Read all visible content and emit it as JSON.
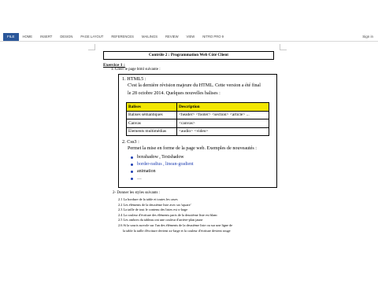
{
  "ribbon": {
    "file_tab": "FILE",
    "tabs": [
      "HOME",
      "INSERT",
      "DESIGN",
      "PAGE LAYOUT",
      "REFERENCES",
      "MAILINGS",
      "REVIEW",
      "VIEW",
      "NITRO PRO 9"
    ],
    "sign_in": "Sign in"
  },
  "document": {
    "title": "Contrôle 2 : Programmation Web Côté Client",
    "exercise_title": "Exercice 1 :",
    "q1": "1.   Créer le page html suivante :",
    "html5": {
      "heading": "1.  HTML5 :",
      "desc_line1": "C'est la dernière révision majeure du HTML. Cette version a été final",
      "desc_line2": "le 28 octobre 2014. Quelques nouvelles balises :"
    },
    "table": {
      "headers": [
        "Balises",
        "Description"
      ],
      "rows": [
        [
          "Balises sémantiques",
          "<header> <footer> <section> <article> ..."
        ],
        [
          "Canvas",
          "<canvas>"
        ],
        [
          "Elements multimédias",
          "<audio> <video>"
        ]
      ]
    },
    "css3": {
      "heading": "2.  Css3 :",
      "desc": "Permet la mise en forme de la page web. Exemples de nouveautés :"
    },
    "bullets": [
      "boxshadow , Textshadow",
      "border-radius , linean-gradient",
      "animation",
      "…"
    ],
    "q2": "2-   Donner les styles suivants :",
    "steps": [
      "2.1 La bordure de la table et toutes les cases",
      "2.2 Les éléments de la deuxième liste avec un 'square'",
      "2.3 La taille de tout le contenu des listes est x-large",
      "2.4 La couleur d'écriture des éléments paris de la deuxième liste est blanc",
      "2.5 Les ombres du tableau ont une couleur d'arrière-plan jaune",
      "2.6 Si la souris survole sur l'un des éléments de la deuxième liste ou sur une ligne de",
      "la table  la taille d'écriture devient xx-large et la couleur d'écriture devient rouge"
    ]
  },
  "colors": {
    "file_tab": "#2b579a",
    "table_header": "#f2e600",
    "bullet": "#1f3fb3",
    "link_text": "#1f3fb3"
  }
}
